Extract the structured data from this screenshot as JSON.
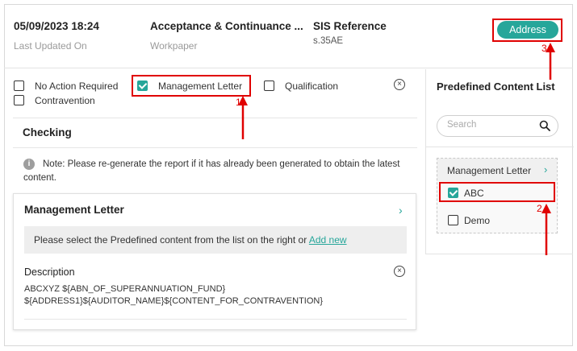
{
  "header": {
    "date_value": "05/09/2023 18:24",
    "date_label": "Last Updated On",
    "workpaper_value": "Acceptance & Continuance ...",
    "workpaper_label": "Workpaper",
    "sis_value": "SIS Reference",
    "sis_label": "s.35AE",
    "address_button": "Address"
  },
  "options": {
    "no_action": "No Action Required",
    "management_letter": "Management Letter",
    "qualification": "Qualification",
    "contravention": "Contravention",
    "management_letter_checked": true
  },
  "checking": {
    "title": "Checking"
  },
  "note": {
    "text": "Note: Please re-generate the report if it has already been generated to obtain the latest content."
  },
  "card": {
    "title": "Management Letter",
    "message": "Please select the Predefined content from the list on the right or",
    "add_new": "Add new",
    "description_label": "Description",
    "description_text": "ABCXYZ ${ABN_OF_SUPERANNUATION_FUND}\n${ADDRESS1}${AUDITOR_NAME}${CONTENT_FOR_CONTRAVENTION}"
  },
  "right_panel": {
    "title": "Predefined Content List",
    "search_placeholder": "Search",
    "group_label": "Management Letter",
    "items": [
      {
        "label": "ABC",
        "checked": true
      },
      {
        "label": "Demo",
        "checked": false
      }
    ]
  },
  "annotations": {
    "num1": "1",
    "num2": "2",
    "num3": "3",
    "color": "#e00000"
  },
  "colors": {
    "accent": "#26a69a"
  }
}
